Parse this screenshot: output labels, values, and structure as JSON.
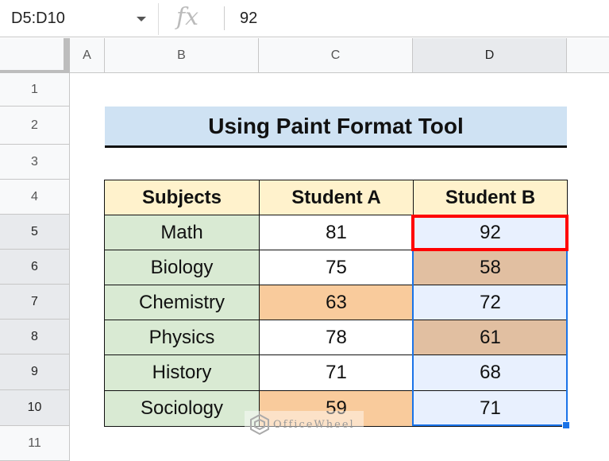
{
  "formula_bar": {
    "name_box": "D5:D10",
    "fx_label": "fx",
    "value": "92"
  },
  "columns": [
    "A",
    "B",
    "C",
    "D"
  ],
  "rows": [
    "1",
    "2",
    "3",
    "4",
    "5",
    "6",
    "7",
    "8",
    "9",
    "10",
    "11"
  ],
  "title": "Using Paint Format Tool",
  "table": {
    "headers": [
      "Subjects",
      "Student A",
      "Student B"
    ],
    "rows": [
      {
        "subject": "Math",
        "a": "81",
        "b": "92"
      },
      {
        "subject": "Biology",
        "a": "75",
        "b": "58"
      },
      {
        "subject": "Chemistry",
        "a": "63",
        "b": "72"
      },
      {
        "subject": "Physics",
        "a": "78",
        "b": "61"
      },
      {
        "subject": "History",
        "a": "71",
        "b": "68"
      },
      {
        "subject": "Sociology",
        "a": "59",
        "b": "71"
      }
    ]
  },
  "colors": {
    "orange": "#f9cb9c",
    "tan": "#e1bfa1",
    "selection": "#e8f0fe",
    "selection_border": "#1a73e8",
    "highlight": "#ff0000"
  },
  "watermark": "OfficeWheel"
}
